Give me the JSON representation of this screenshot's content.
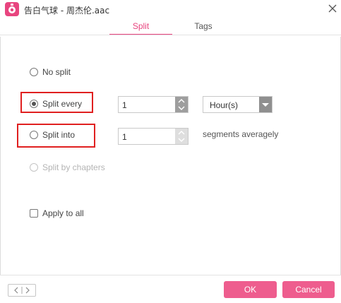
{
  "window": {
    "title": "告白气球 - 周杰伦.aac",
    "app_icon": "music-app-icon",
    "close_icon": "close-icon"
  },
  "tabs": [
    {
      "label": "Split",
      "active": true
    },
    {
      "label": "Tags",
      "active": false
    }
  ],
  "options": {
    "no_split": {
      "label": "No split",
      "checked": false
    },
    "split_every": {
      "label": "Split every",
      "checked": true,
      "value": "1",
      "unit": "Hour(s)"
    },
    "split_into": {
      "label": "Split into",
      "checked": false,
      "value": "1",
      "suffix": "segments averagely"
    },
    "split_by_chapters": {
      "label": "Split by chapters",
      "disabled": true
    },
    "apply_to_all": {
      "label": "Apply to all",
      "checked": false
    }
  },
  "footer": {
    "ok_label": "OK",
    "cancel_label": "Cancel",
    "nav_icon": "prev-next-icon"
  },
  "colors": {
    "accent": "#e8457f",
    "button": "#ee5d8e",
    "highlight": "#e02020"
  }
}
